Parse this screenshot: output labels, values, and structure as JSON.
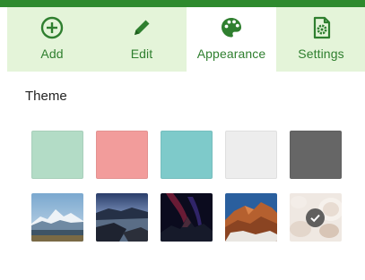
{
  "tabs": [
    {
      "label": "Add",
      "icon": "plus-circle-icon"
    },
    {
      "label": "Edit",
      "icon": "pencil-icon"
    },
    {
      "label": "Appearance",
      "icon": "palette-icon",
      "active": true
    },
    {
      "label": "Settings",
      "icon": "gear-document-icon"
    }
  ],
  "theme": {
    "title": "Theme",
    "colors": [
      "#b3dcc6",
      "#f29c9b",
      "#7ecaca",
      "#ededed",
      "#666666"
    ],
    "images": [
      {
        "name": "snowy-mountain-lake",
        "selected": false
      },
      {
        "name": "rocky-coast-sunset",
        "selected": false
      },
      {
        "name": "aurora-mountain-night",
        "selected": false
      },
      {
        "name": "red-rock-canyon",
        "selected": false
      },
      {
        "name": "seashells",
        "selected": true
      }
    ]
  },
  "colors": {
    "accent": "#2e8a2e",
    "tab_bg": "#e4f4d9",
    "tab_text": "#2f7f2f"
  }
}
